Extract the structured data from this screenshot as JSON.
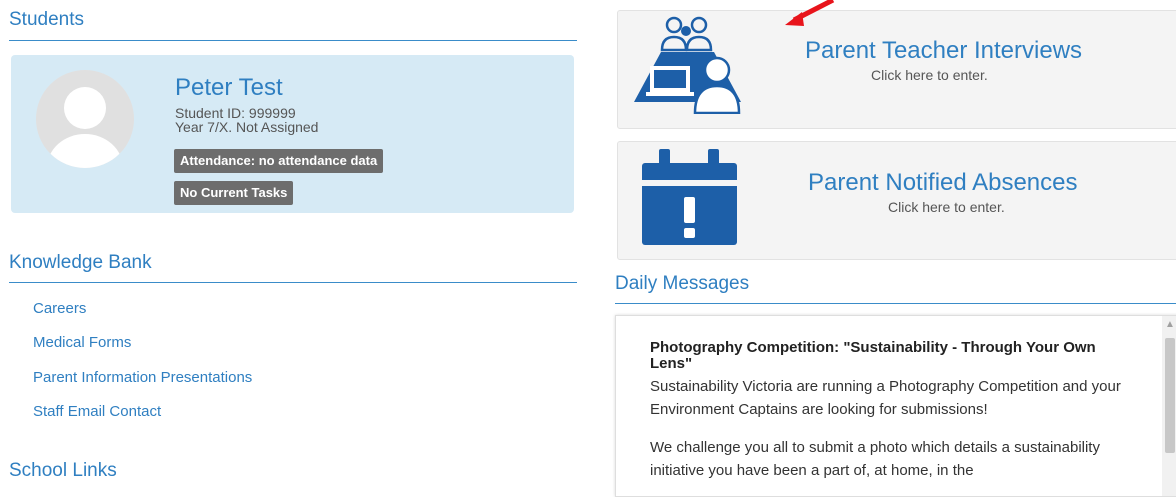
{
  "students": {
    "heading": "Students",
    "student": {
      "name": "Peter Test",
      "id_line": "Student ID: 999999",
      "year_line": "Year 7/X. Not Assigned",
      "attendance_badge": "Attendance: no attendance data",
      "tasks_badge": "No Current Tasks"
    }
  },
  "knowledge_bank": {
    "heading": "Knowledge Bank",
    "links": [
      "Careers",
      "Medical Forms",
      "Parent Information Presentations",
      "Staff Email Contact"
    ]
  },
  "school_links": {
    "heading": "School Links"
  },
  "tiles": {
    "interviews": {
      "title": "Parent Teacher Interviews",
      "subtitle": "Click here to enter."
    },
    "absences": {
      "title": "Parent Notified Absences",
      "subtitle": "Click here to enter."
    }
  },
  "daily_messages": {
    "heading": "Daily Messages",
    "message": {
      "title": "Photography Competition: \"Sustainability - Through Your Own Lens\"",
      "para1": "Sustainability Victoria are running a Photography Competition and your Environment Captains are looking for submissions!",
      "para2": "We challenge you all to submit a photo which details a sustainability initiative you have been a part of, at home, in the"
    }
  },
  "colors": {
    "accent": "#2f7fc1",
    "card_bg": "#d6eaf5",
    "badge_bg": "#6d6d6d",
    "icon_blue": "#1d5fa8",
    "annotation_arrow": "#e8141b"
  },
  "icons": {
    "interviews": "parent-teacher-icon",
    "absences": "calendar-alert-icon",
    "avatar": "user-avatar",
    "arrow": "red-arrow"
  }
}
